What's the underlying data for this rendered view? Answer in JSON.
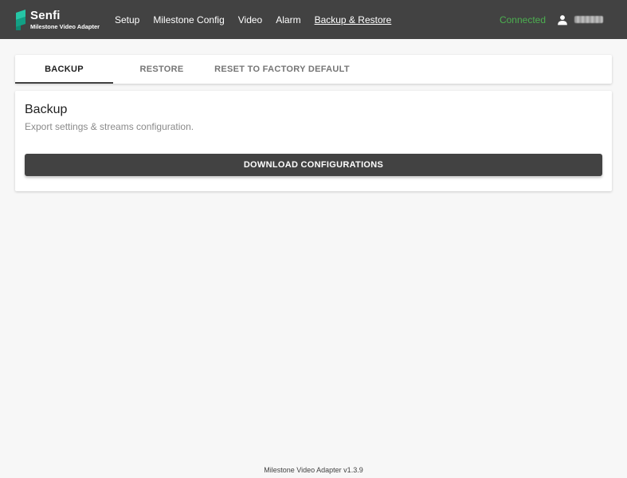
{
  "header": {
    "brand_name": "Senfi",
    "brand_subtitle": "Milestone Video Adapter",
    "logo_icon": "senfi-logo-icon",
    "nav": [
      {
        "label": "Setup",
        "active": false
      },
      {
        "label": "Milestone Config",
        "active": false
      },
      {
        "label": "Video",
        "active": false
      },
      {
        "label": "Alarm",
        "active": false
      },
      {
        "label": "Backup & Restore",
        "active": true
      }
    ],
    "status": "Connected",
    "user_icon": "person-icon"
  },
  "tabs": [
    {
      "label": "BACKUP",
      "active": true
    },
    {
      "label": "RESTORE",
      "active": false
    },
    {
      "label": "RESET TO FACTORY DEFAULT",
      "active": false
    }
  ],
  "backup": {
    "title": "Backup",
    "description": "Export settings & streams configuration.",
    "button_label": "DOWNLOAD CONFIGURATIONS"
  },
  "footer": {
    "version_text": "Milestone Video Adapter v1.3.9"
  },
  "colors": {
    "topbar": "#424242",
    "accent_logo": "#1abc9c",
    "status_connected": "#4caf50",
    "button": "#424242"
  }
}
